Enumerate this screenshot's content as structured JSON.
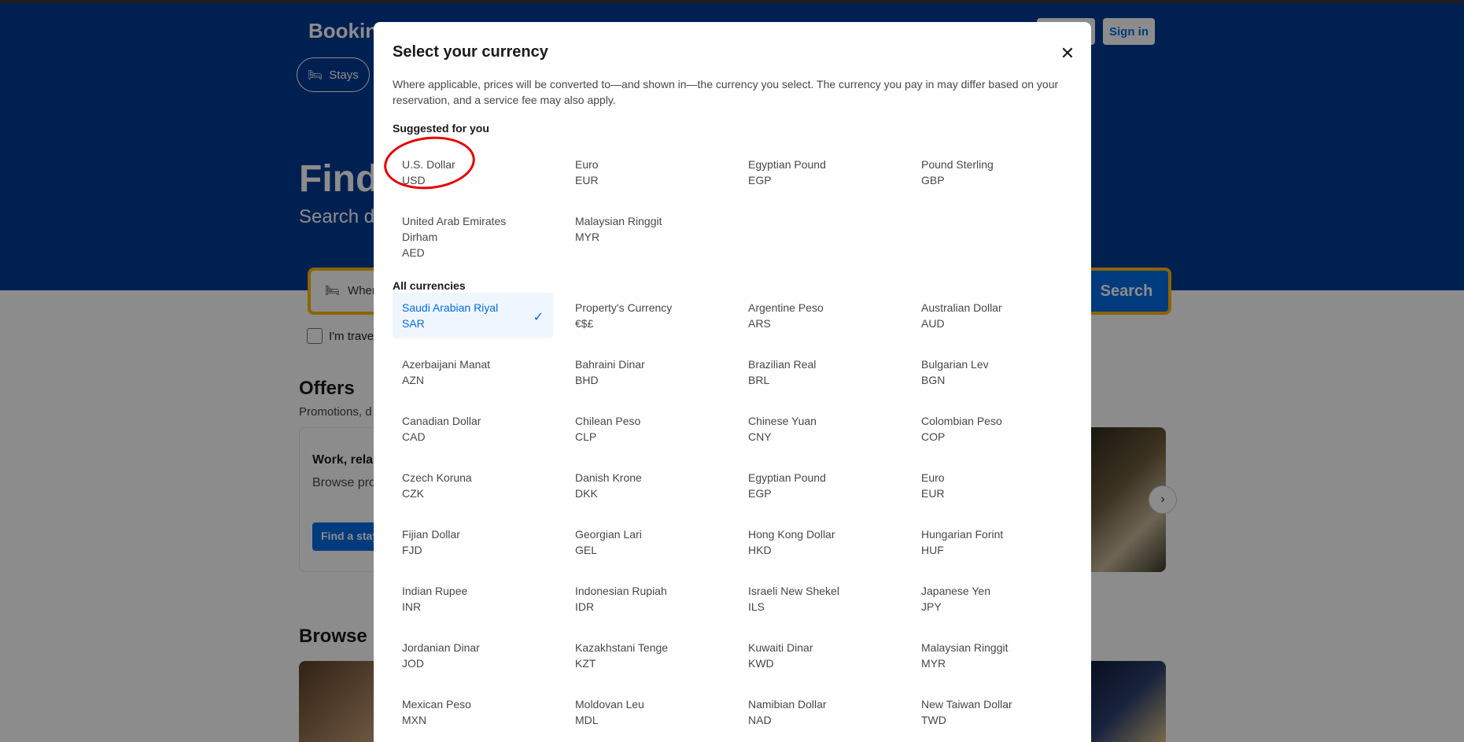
{
  "header": {
    "logo": "Booking",
    "register_label": "",
    "signin_label": "Sign in",
    "stays_label": "Stays"
  },
  "hero": {
    "title": "Find",
    "subtitle": "Search d",
    "search_placeholder": "Wher",
    "search_button": "Search",
    "travel_label": "I'm travel"
  },
  "offers": {
    "title": "Offers",
    "subtitle": "Promotions, d",
    "card_title": "Work, rela",
    "card_desc": "Browse pro stays, many",
    "card_button": "Find a stay"
  },
  "browse": {
    "title": "Browse l"
  },
  "modal": {
    "title": "Select your currency",
    "description": "Where applicable, prices will be converted to—and shown in—the currency you select. The currency you pay in may differ based on your reservation, and a service fee may also apply.",
    "suggested_heading": "Suggested for you",
    "all_heading": "All currencies",
    "suggested": [
      {
        "name": "U.S. Dollar",
        "code": "USD"
      },
      {
        "name": "Euro",
        "code": "EUR"
      },
      {
        "name": "Egyptian Pound",
        "code": "EGP"
      },
      {
        "name": "Pound Sterling",
        "code": "GBP"
      },
      {
        "name": "United Arab Emirates Dirham",
        "code": "AED"
      },
      {
        "name": "Malaysian Ringgit",
        "code": "MYR"
      }
    ],
    "all": [
      {
        "name": "Saudi Arabian Riyal",
        "code": "SAR"
      },
      {
        "name": "Property's Currency",
        "code": "€$£"
      },
      {
        "name": "Argentine Peso",
        "code": "ARS"
      },
      {
        "name": "Australian Dollar",
        "code": "AUD"
      },
      {
        "name": "Azerbaijani Manat",
        "code": "AZN"
      },
      {
        "name": "Bahraini Dinar",
        "code": "BHD"
      },
      {
        "name": "Brazilian Real",
        "code": "BRL"
      },
      {
        "name": "Bulgarian Lev",
        "code": "BGN"
      },
      {
        "name": "Canadian Dollar",
        "code": "CAD"
      },
      {
        "name": "Chilean Peso",
        "code": "CLP"
      },
      {
        "name": "Chinese Yuan",
        "code": "CNY"
      },
      {
        "name": "Colombian Peso",
        "code": "COP"
      },
      {
        "name": "Czech Koruna",
        "code": "CZK"
      },
      {
        "name": "Danish Krone",
        "code": "DKK"
      },
      {
        "name": "Egyptian Pound",
        "code": "EGP"
      },
      {
        "name": "Euro",
        "code": "EUR"
      },
      {
        "name": "Fijian Dollar",
        "code": "FJD"
      },
      {
        "name": "Georgian Lari",
        "code": "GEL"
      },
      {
        "name": "Hong Kong Dollar",
        "code": "HKD"
      },
      {
        "name": "Hungarian Forint",
        "code": "HUF"
      },
      {
        "name": "Indian Rupee",
        "code": "INR"
      },
      {
        "name": "Indonesian Rupiah",
        "code": "IDR"
      },
      {
        "name": "Israeli New Shekel",
        "code": "ILS"
      },
      {
        "name": "Japanese Yen",
        "code": "JPY"
      },
      {
        "name": "Jordanian Dinar",
        "code": "JOD"
      },
      {
        "name": "Kazakhstani Tenge",
        "code": "KZT"
      },
      {
        "name": "Kuwaiti Dinar",
        "code": "KWD"
      },
      {
        "name": "Malaysian Ringgit",
        "code": "MYR"
      },
      {
        "name": "Mexican Peso",
        "code": "MXN"
      },
      {
        "name": "Moldovan Leu",
        "code": "MDL"
      },
      {
        "name": "Namibian Dollar",
        "code": "NAD"
      },
      {
        "name": "New Taiwan Dollar",
        "code": "TWD"
      }
    ],
    "selected_code": "SAR"
  },
  "colors": {
    "brand": "#003b95",
    "accent": "#006ce4",
    "annotation": "#e60000"
  }
}
